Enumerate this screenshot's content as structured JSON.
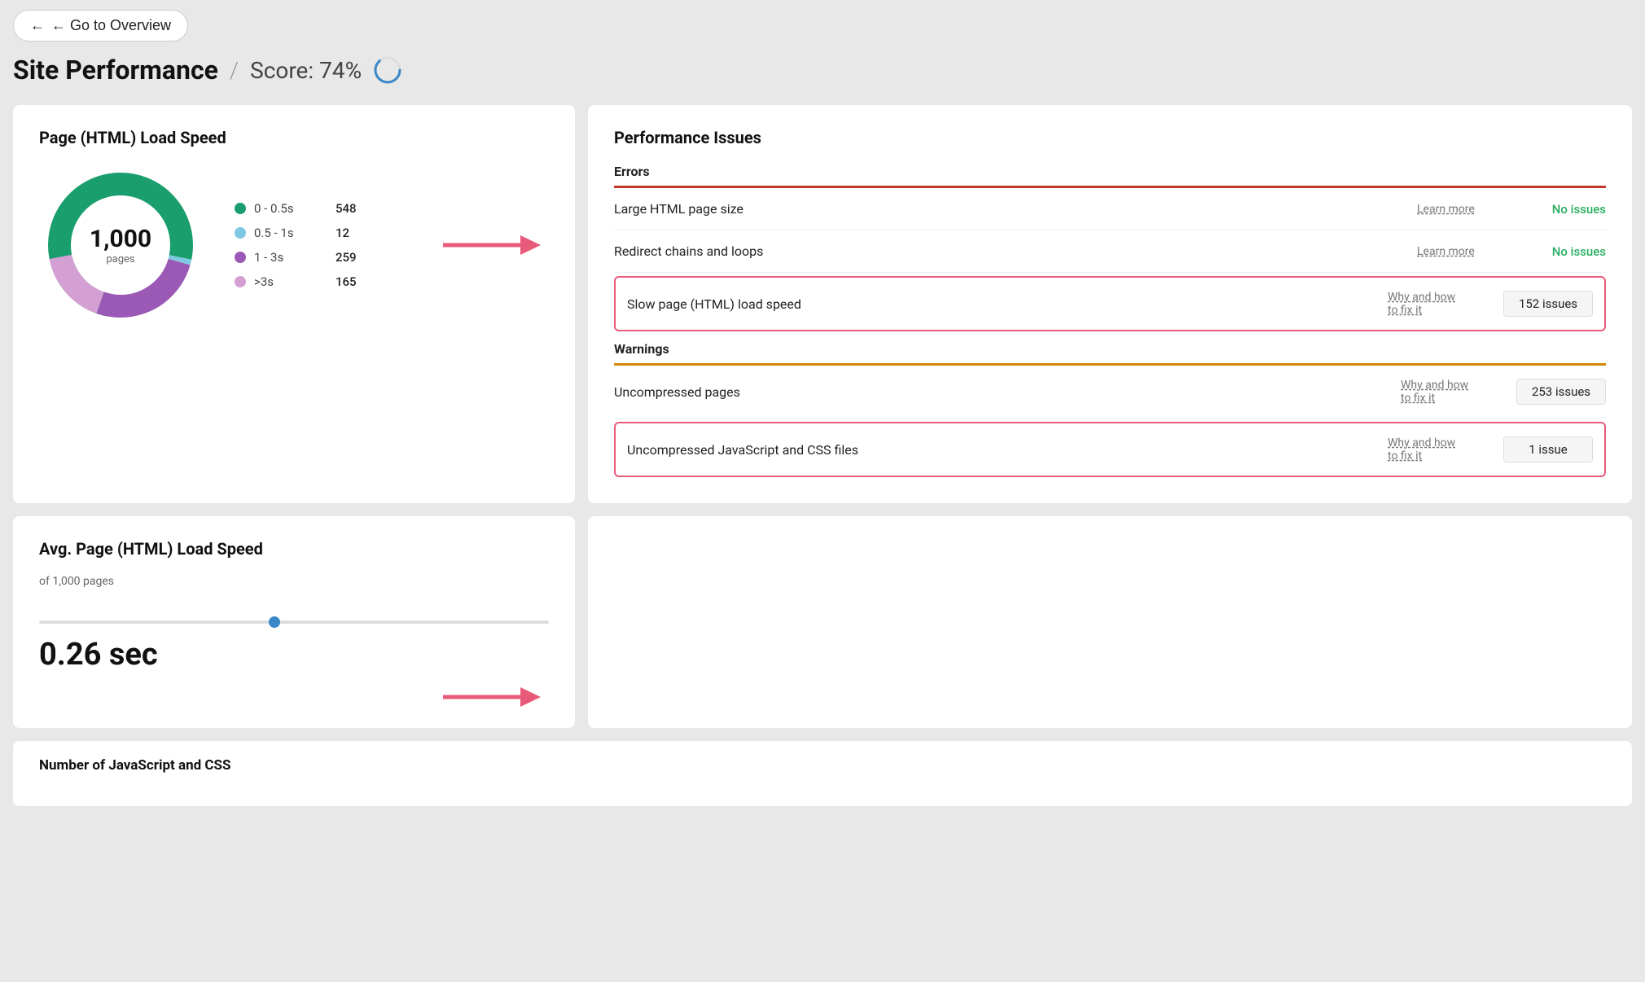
{
  "nav": {
    "back_button": "← Go to Overview"
  },
  "header": {
    "title": "Site Performance",
    "score_divider": "/",
    "score_label": "Score: 74%"
  },
  "left_card_1": {
    "title": "Page (HTML) Load Speed",
    "donut": {
      "center_number": "1,000",
      "center_label": "pages",
      "segments": [
        {
          "label": "0 - 0.5s",
          "value": "548",
          "color": "#1a9e6e"
        },
        {
          "label": "0.5 - 1s",
          "value": "12",
          "color": "#7ec8e3"
        },
        {
          "label": "1 - 3s",
          "value": "259",
          "color": "#9b59b6"
        },
        {
          "label": ">3s",
          "value": "165",
          "color": "#d4a0d4"
        }
      ]
    }
  },
  "left_card_2": {
    "title": "Avg. Page (HTML) Load Speed",
    "subtitle": "of 1,000 pages",
    "value": "0.26 sec"
  },
  "left_card_3": {
    "title": "Number of JavaScript and CSS"
  },
  "performance_issues": {
    "title": "Performance Issues",
    "errors_label": "Errors",
    "warnings_label": "Warnings",
    "items": [
      {
        "id": "large-html",
        "name": "Large HTML page size",
        "link": "Learn more",
        "status_text": "No issues",
        "highlighted": false,
        "section": "errors"
      },
      {
        "id": "redirect-chains",
        "name": "Redirect chains and loops",
        "link": "Learn more",
        "status_text": "No issues",
        "highlighted": false,
        "section": "errors"
      },
      {
        "id": "slow-html",
        "name": "Slow page (HTML) load speed",
        "link": "Why and how to fix it",
        "badge": "152 issues",
        "highlighted": true,
        "section": "errors"
      },
      {
        "id": "uncompressed-pages",
        "name": "Uncompressed pages",
        "link": "Why and how to fix it",
        "badge": "253 issues",
        "highlighted": false,
        "section": "warnings"
      },
      {
        "id": "uncompressed-js-css",
        "name": "Uncompressed JavaScript and CSS files",
        "link": "Why and how to fix it",
        "badge": "1 issue",
        "highlighted": true,
        "section": "warnings"
      }
    ]
  }
}
